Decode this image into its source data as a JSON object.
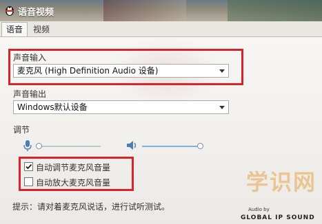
{
  "window": {
    "title": "语音视频"
  },
  "tabs": [
    {
      "label": "语音",
      "active": true
    },
    {
      "label": "视频",
      "active": false
    }
  ],
  "input": {
    "label": "声音输入",
    "device": "麦克风 (High Definition Audio 设备)"
  },
  "output": {
    "label": "声音输出",
    "device": "Windows默认设备"
  },
  "adjust": {
    "label": "调节",
    "mic_level": 0.0,
    "speaker_level": 1.0
  },
  "options": [
    {
      "label": "自动调节麦克风音量",
      "checked": true
    },
    {
      "label": "自动放大麦克风音量",
      "checked": false
    }
  ],
  "hint": "提示：请对着麦克风说话，进行试听测试。",
  "watermark": "学识网",
  "audio_by": "Audio by",
  "audio_brand": "GLOBAL IP SOUND",
  "colors": {
    "highlight": "#d8232a",
    "slider": "#7fb0d8"
  }
}
